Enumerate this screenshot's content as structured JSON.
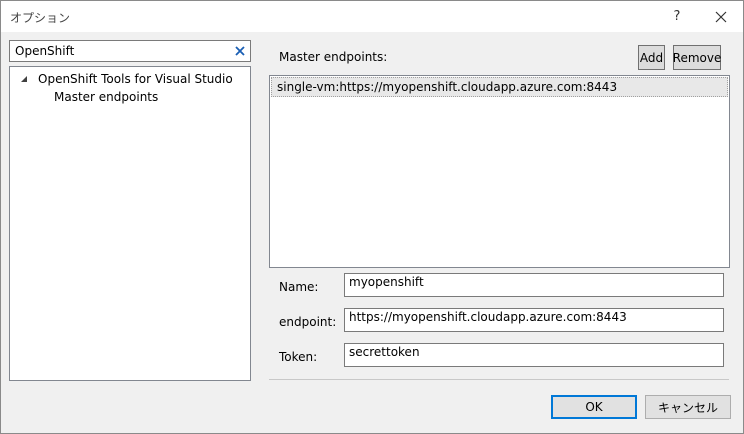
{
  "window": {
    "title": "オプション",
    "help_label": "?"
  },
  "search": {
    "value": "OpenShift",
    "placeholder": ""
  },
  "tree": {
    "root_label": "OpenShift Tools for Visual Studio",
    "child_label": "Master endpoints"
  },
  "endpoints": {
    "section_label": "Master endpoints:",
    "add_label": "Add",
    "remove_label": "Remove",
    "items": [
      "single-vm:https://myopenshift.cloudapp.azure.com:8443"
    ]
  },
  "form": {
    "name_label": "Name:",
    "name_value": "myopenshift",
    "endpoint_label": "endpoint:",
    "endpoint_value": "https://myopenshift.cloudapp.azure.com:8443",
    "token_label": "Token:",
    "token_value": "secrettoken"
  },
  "buttons": {
    "ok_label": "OK",
    "cancel_label": "キャンセル"
  },
  "colors": {
    "accent": "#0078d7",
    "window_bg": "#f0f0f0",
    "selection": "#e8e8e8"
  }
}
